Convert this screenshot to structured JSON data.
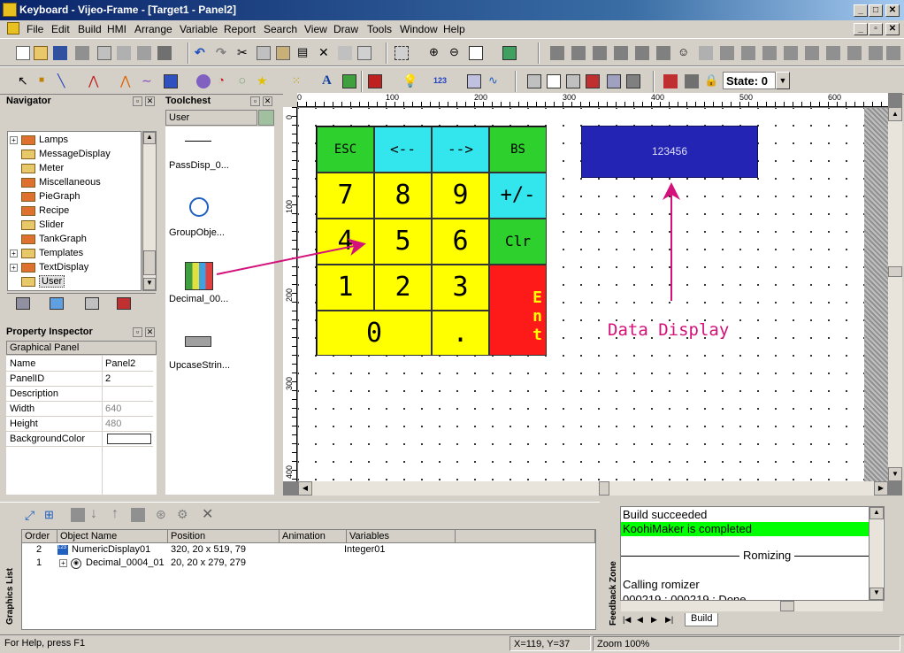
{
  "window": {
    "title": "Keyboard - Vijeo-Frame - [Target1 - Panel2]",
    "controls": {
      "minimize": "_",
      "maximize": "□",
      "close": "✕"
    }
  },
  "menu": [
    "File",
    "Edit",
    "Build",
    "HMI",
    "Arrange",
    "Variable",
    "Report",
    "Search",
    "View",
    "Draw",
    "Tools",
    "Window",
    "Help"
  ],
  "toolbar": {
    "state_label": "State: 0"
  },
  "navigator": {
    "title": "Navigator",
    "items": [
      {
        "label": "Lamps",
        "expandable": true
      },
      {
        "label": "MessageDisplay",
        "expandable": false
      },
      {
        "label": "Meter",
        "expandable": false
      },
      {
        "label": "Miscellaneous",
        "expandable": false
      },
      {
        "label": "PieGraph",
        "expandable": false
      },
      {
        "label": "Recipe",
        "expandable": false
      },
      {
        "label": "Slider",
        "expandable": false
      },
      {
        "label": "TankGraph",
        "expandable": false
      },
      {
        "label": "Templates",
        "expandable": true
      },
      {
        "label": "TextDisplay",
        "expandable": true
      },
      {
        "label": "User",
        "expandable": false
      }
    ]
  },
  "property_inspector": {
    "title": "Property Inspector",
    "section": "Graphical Panel",
    "rows": [
      {
        "key": "Name",
        "value": "Panel2"
      },
      {
        "key": "PanelID",
        "value": "2"
      },
      {
        "key": "Description",
        "value": ""
      },
      {
        "key": "Width",
        "value": "640"
      },
      {
        "key": "Height",
        "value": "480"
      },
      {
        "key": "BackgroundColor",
        "value": ""
      }
    ]
  },
  "toolchest": {
    "title": "Toolchest",
    "category": "User",
    "items": [
      "PassDisp_0...",
      "GroupObje...",
      "Decimal_00...",
      "UpcaseStrin..."
    ]
  },
  "ruler": {
    "h_labels": [
      "0",
      "100",
      "200",
      "300",
      "400",
      "500",
      "600"
    ],
    "v_labels": [
      "0",
      "100",
      "200",
      "300",
      "400"
    ]
  },
  "keypad": {
    "keys": [
      "ESC",
      "<--",
      "-->",
      "BS",
      "7",
      "8",
      "9",
      "+/-",
      "4",
      "5",
      "6",
      "Clr",
      "1",
      "2",
      "3",
      "Ent",
      "0",
      "."
    ]
  },
  "numeric_display": {
    "value": "123456"
  },
  "annotation": {
    "text": "Data Display"
  },
  "graphics_list": {
    "label": "Graphics List",
    "columns": [
      "Order",
      "Object Name",
      "Position",
      "Animation",
      "Variables"
    ],
    "rows": [
      {
        "order": "2",
        "name": "NumericDisplay01",
        "position": "320, 20 x 519, 79",
        "animation": "",
        "variables": "Integer01"
      },
      {
        "order": "1",
        "name": "Decimal_0004_01",
        "position": "20, 20 x 279, 279",
        "animation": "",
        "variables": ""
      }
    ]
  },
  "feedback": {
    "label": "Feedback Zone",
    "lines": [
      "Build succeeded",
      "KoohiMaker is completed",
      "Romizing",
      "Calling romizer",
      "000219 : 000219 : Done"
    ],
    "tab": "Build"
  },
  "statusbar": {
    "help": "For Help, press F1",
    "coords": "X=119, Y=37",
    "zoom": "Zoom 100%"
  }
}
